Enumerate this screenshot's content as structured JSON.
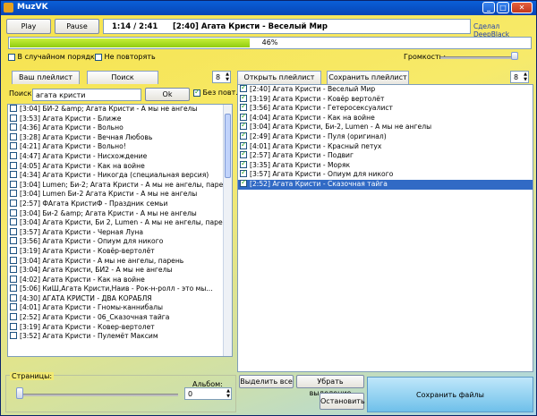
{
  "window": {
    "title": "MuzVK"
  },
  "player": {
    "play_label": "Play",
    "pause_label": "Pause",
    "time": "1:14 /  2:41",
    "track": "[2:40]  Агата Кристи - Веселый Мир",
    "credit": "Сделал DeepBlack",
    "progress_percent": 46,
    "progress_label": "46%",
    "shuffle_label": "В случайном порядке",
    "no_repeat_label": "Не повторять",
    "volume_label": "Громкость:"
  },
  "left": {
    "tab_playlist": "Ваш плейлист",
    "tab_search": "Поиск",
    "spin_value": "8",
    "search_label": "Поиск:",
    "search_value": "агата кристи",
    "ok_label": "Ok",
    "no_rep_label": "Без повт.",
    "items": [
      "[3:04]  БИ-2 &amp; Агата Кристи - А мы не ангелы",
      "[3:53]  Агата Кристи - Ближе",
      "[4:36]  Агата Кристи - Вольно",
      "[3:28]  Агата Кристи - Вечная Любовь",
      "[4:21]  Агата Кристи - Вольно!",
      "[4:47]  Агата Кристи - Нисхождение",
      "[4:05]  Агата Кристи - Как на войне",
      "[4:34]  Агата Кристи - Никогда (специальная версия)",
      "[3:04]  Lumen; Би-2; Агата Кристи - А мы не ангелы, парень",
      "[3:04]  Lumen Би-2 Агата Кристи - А мы не ангелы",
      "[2:57]  ФАгата КристиФ - Праздник семьи",
      "[3:04]  Би-2 &amp; Агата Кристи - А мы не ангелы",
      "[3:04]  Агата Кристи, Би 2, Lumen - А мы не ангелы, парень",
      "[3:57]  Агата Кристи - Черная Луна",
      "[3:56]  Агата Кристи - Опиум для никого",
      "[3:19]  Агата Кристи - Ковёр-вертолёт",
      "[3:04]  Агата Кристи - А мы не ангелы, парень",
      "[3:04]  Агата Кристи, БИ2 - А мы не ангелы",
      "[4:02]  Агата Кристи - Как на войне",
      "[5:06]  КиШ,Агата Кристи,Наив - Рок-н-ролл - это мы...",
      "[4:30]  АГАТА КРИСТИ - ДВА КОРАБЛЯ",
      "[4:01]  Агата Кристи - Гномы-каннибалы",
      "[2:52]  Агата Кристи - 06_Сказочная тайга",
      "[3:19]  Агата Кристи - Ковер-вертолет",
      "[3:52]  Агата Кристи - Пулемёт Максим"
    ],
    "pages_label": "Страницы:",
    "album_label": "Альбом:",
    "album_value": "0"
  },
  "right": {
    "open_playlist": "Открыть плейлист",
    "save_playlist": "Сохранить плейлист",
    "spin_value": "8",
    "items": [
      "[2:40]  Агата Кристи - Веселый Мир",
      "[3:19]  Агата Кристи - Ковёр вертолёт",
      "[3:56]  Агата Кристи - Гетеросексуалист",
      "[4:04]  Агата Кристи - Как на войне",
      "[3:04]  Агата Кристи, Би-2, Lumen - А мы не ангелы",
      "[2:49]  Агата Кристи - Пуля (оригинал)",
      "[4:01]  Агата Кристи - Красный петух",
      "[2:57]  Агата Кристи - Подвиг",
      "[3:35]  Агата Кристи - Моряк",
      "[3:57]  Агата Кристи - Опиум для никого",
      "[2:52]  Агата Кристи - Сказочная тайга"
    ],
    "select_all": "Выделить все",
    "deselect": "Убрать выделение",
    "stop": "Остановить",
    "save_files": "Сохранить файлы"
  }
}
